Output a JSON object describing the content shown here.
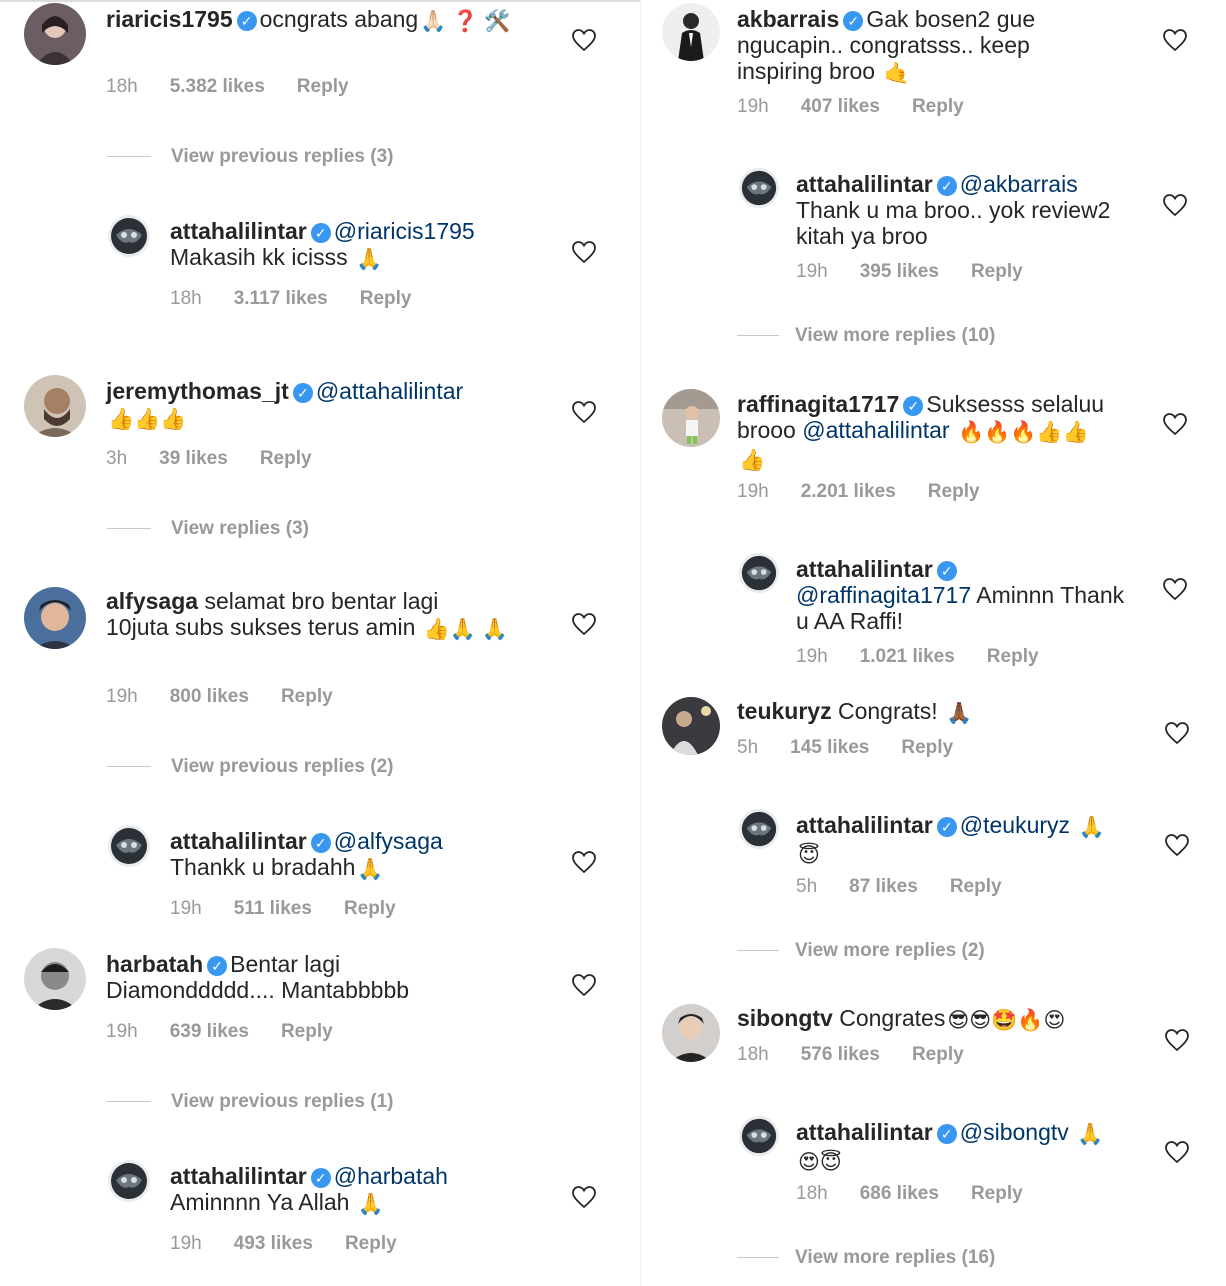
{
  "verified_mark": "✓",
  "heart_icon": "heart-outline-icon",
  "colors": {
    "mention": "#003569",
    "verified": "#3897f0",
    "meta": "#999999"
  },
  "left": {
    "c1": {
      "user": "riaricis1795",
      "text": "ocngrats abang",
      "emoji": "🙏🏻 ❓ 🛠️",
      "time": "18h",
      "likes": "5.382 likes",
      "reply": "Reply"
    },
    "v1": "View previous replies (3)",
    "r1": {
      "user": "attahalilintar",
      "mention": "@riaricis1795",
      "text": "Makasih kk icisss",
      "emoji": "🙏",
      "time": "18h",
      "likes": "3.117 likes",
      "reply": "Reply"
    },
    "c2": {
      "user": "jeremythomas_jt",
      "mention": "@attahalilintar",
      "emoji": "👍👍👍",
      "time": "3h",
      "likes": "39 likes",
      "reply": "Reply"
    },
    "v2": "View replies (3)",
    "c3": {
      "user": "alfysaga",
      "text1": "selamat bro bentar lagi",
      "text2": "10juta subs sukses terus amin",
      "emoji": "👍🙏 🙏",
      "time": "19h",
      "likes": "800 likes",
      "reply": "Reply"
    },
    "v3": "View previous replies (2)",
    "r3": {
      "user": "attahalilintar",
      "mention": "@alfysaga",
      "text": "Thankk u bradahh",
      "emoji": "🙏",
      "time": "19h",
      "likes": "511 likes",
      "reply": "Reply"
    },
    "c4": {
      "user": "harbatah",
      "text1": "Bentar lagi",
      "text2": "Diamonddddd.... Mantabbbbb",
      "time": "19h",
      "likes": "639 likes",
      "reply": "Reply"
    },
    "v4": "View previous replies (1)",
    "r4": {
      "user": "attahalilintar",
      "mention": "@harbatah",
      "text": "Aminnnn Ya Allah",
      "emoji": "🙏",
      "time": "19h",
      "likes": "493 likes",
      "reply": "Reply"
    }
  },
  "right": {
    "c1": {
      "user": "akbarrais",
      "text1": "Gak bosen2 gue",
      "text2": "ngucapin.. congratsss.. keep",
      "text3": "inspiring broo",
      "emoji": "🤙",
      "time": "19h",
      "likes": "407 likes",
      "reply": "Reply"
    },
    "r1": {
      "user": "attahalilintar",
      "mention": "@akbarrais",
      "text1": "Thank u ma broo.. yok review2",
      "text2": "kitah ya broo",
      "time": "19h",
      "likes": "395 likes",
      "reply": "Reply"
    },
    "v1": "View more replies (10)",
    "c2": {
      "user": "raffinagita1717",
      "text1": "Suksesss selaluu",
      "text2": "brooo",
      "mention": "@attahalilintar",
      "emoji": "🔥🔥🔥👍👍",
      "emoji2": "👍",
      "time": "19h",
      "likes": "2.201 likes",
      "reply": "Reply"
    },
    "r2": {
      "user": "attahalilintar",
      "mention": "@raffinagita1717",
      "text1": "Aminnn Thank",
      "text2": "u AA Raffi!",
      "time": "19h",
      "likes": "1.021 likes",
      "reply": "Reply"
    },
    "c3": {
      "user": "teukuryz",
      "text": "Congrats!",
      "emoji": "🙏🏾",
      "time": "5h",
      "likes": "145 likes",
      "reply": "Reply"
    },
    "r3": {
      "user": "attahalilintar",
      "mention": "@teukuryz",
      "emoji": "🙏",
      "emoji2": "😇",
      "time": "5h",
      "likes": "87 likes",
      "reply": "Reply"
    },
    "v3": "View more replies (2)",
    "c4": {
      "user": "sibongtv",
      "text": "Congrates",
      "emoji": "😎😎🤩🔥😍",
      "time": "18h",
      "likes": "576 likes",
      "reply": "Reply"
    },
    "r4": {
      "user": "attahalilintar",
      "mention": "@sibongtv",
      "emoji": "🙏",
      "emoji2": "😍😇",
      "time": "18h",
      "likes": "686 likes",
      "reply": "Reply"
    },
    "v4": "View more replies (16)"
  }
}
